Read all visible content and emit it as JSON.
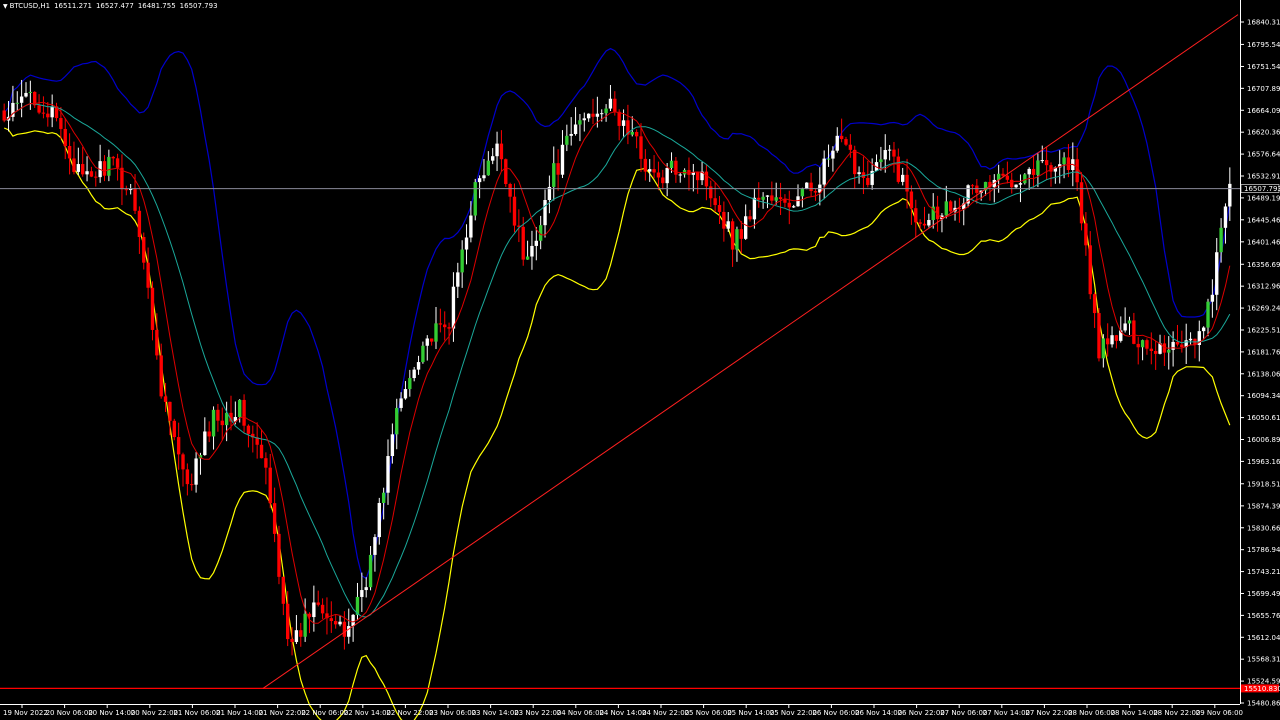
{
  "header": {
    "symbol": "BTCUSD,H1",
    "open": "16511.271",
    "high": "16527.477",
    "low": "16481.755",
    "close": "16507.793"
  },
  "colors": {
    "background": "#000000",
    "axis_text": "#ffffff",
    "bull": "#ffffff",
    "bull_body_green": "#33cc33",
    "bear": "#ff0000",
    "bb_upper": "#0000cc",
    "bb_lower": "#ffff00",
    "ma_fast": "#dd0000",
    "ma_mid": "#1aa89a",
    "current_price_line": "#8a8a99",
    "support_line": "#ff0000",
    "trend_line": "#ff2020"
  },
  "chart_data": {
    "type": "candlestick",
    "timeframe": "H1",
    "symbol": "BTCUSD",
    "ylim": [
      15480.865,
      16862.04
    ],
    "y_ticks": [
      "16840.315",
      "16795.540",
      "16751.540",
      "16707.890",
      "16664.090",
      "16620.365",
      "16576.640",
      "16532.915",
      "16489.190",
      "16445.465",
      "16401.465",
      "16356.690",
      "16312.965",
      "16269.240",
      "16225.515",
      "16181.765",
      "16138.065",
      "16094.340",
      "16050.615",
      "16006.890",
      "15963.165",
      "15918.515",
      "15874.390",
      "15830.665",
      "15786.940",
      "15743.215",
      "15699.490",
      "15655.765",
      "15612.040",
      "15568.315",
      "15524.590",
      "15480.865"
    ],
    "x_ticks": [
      "19 Nov 2022",
      "20 Nov 06:00",
      "20 Nov 14:00",
      "20 Nov 22:00",
      "21 Nov 06:00",
      "21 Nov 14:00",
      "21 Nov 22:00",
      "22 Nov 06:00",
      "22 Nov 14:00",
      "22 Nov 22:00",
      "23 Nov 06:00",
      "23 Nov 14:00",
      "23 Nov 22:00",
      "24 Nov 06:00",
      "24 Nov 14:00",
      "24 Nov 22:00",
      "25 Nov 06:00",
      "25 Nov 14:00",
      "25 Nov 22:00",
      "26 Nov 06:00",
      "26 Nov 14:00",
      "26 Nov 22:00",
      "27 Nov 06:00",
      "27 Nov 14:00",
      "27 Nov 22:00",
      "28 Nov 06:00",
      "28 Nov 14:00",
      "28 Nov 22:00",
      "29 Nov 06:00"
    ],
    "current_price": 16507.793,
    "current_price_label": "16507.793",
    "support_level": 15510,
    "support_label": "15510.830",
    "key_closes": [
      16640,
      16700,
      16640,
      16520,
      16560,
      16490,
      16120,
      15900,
      16050,
      16070,
      15950,
      15580,
      15700,
      15610,
      15750,
      16050,
      16200,
      16230,
      16500,
      16590,
      16350,
      16530,
      16640,
      16680,
      16620,
      16520,
      16560,
      16520,
      16400,
      16500,
      16470,
      16510,
      16600,
      16530,
      16580,
      16450,
      16470,
      16500,
      16520,
      16540,
      16560,
      16560,
      16180,
      16230,
      16190,
      16200,
      16220,
      16510
    ],
    "indicators": [
      "Bollinger Bands upper",
      "Bollinger Bands lower",
      "Moving average (red)",
      "Moving average (teal)"
    ]
  }
}
